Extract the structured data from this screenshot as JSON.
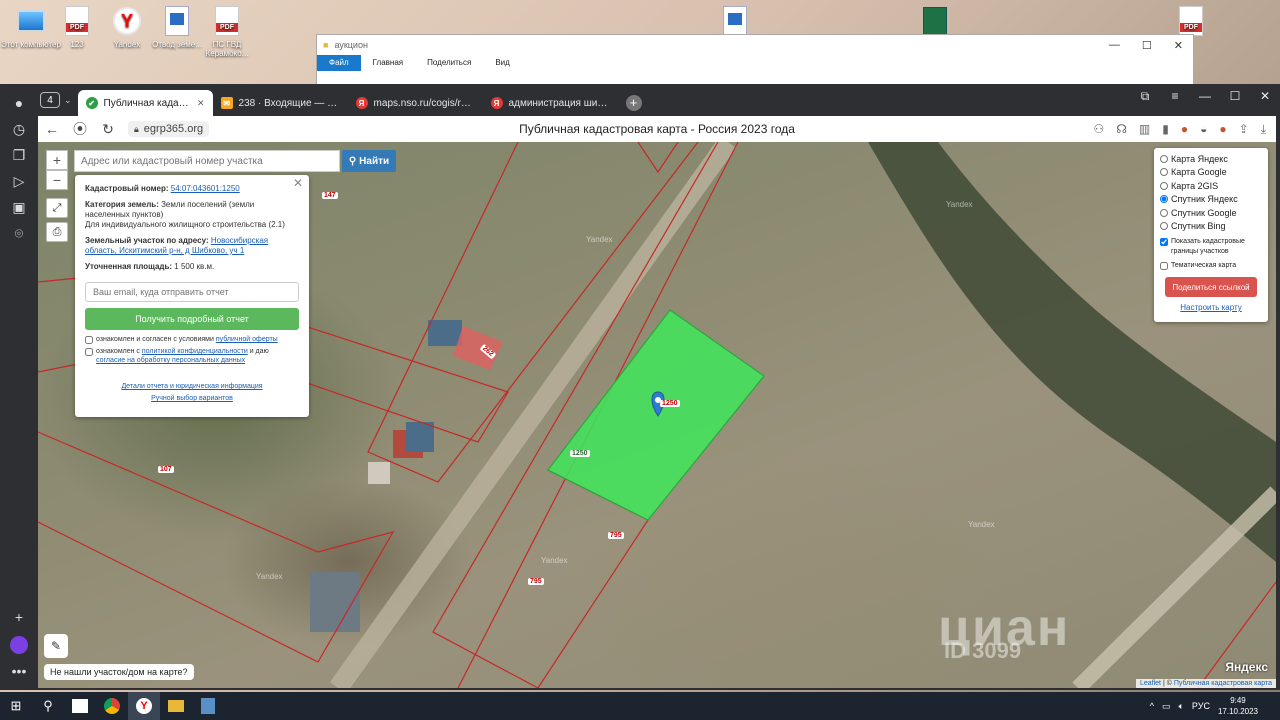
{
  "desktop": {
    "icons": [
      {
        "label": "Этот компьютер",
        "type": "pc"
      },
      {
        "label": "123",
        "type": "pdf"
      },
      {
        "label": "Yandex",
        "type": "yandex"
      },
      {
        "label": "Отвод земе...",
        "type": "doc"
      },
      {
        "label": "ПС ГВД Керамоко...",
        "type": "pdf"
      }
    ]
  },
  "explorer": {
    "title": "аукцион",
    "ribbon": [
      "Файл",
      "Главная",
      "Поделиться",
      "Вид"
    ]
  },
  "browser": {
    "tab_count": "4",
    "tabs": [
      {
        "label": "Публичная кадастрова",
        "icon_color": "#2e9e44",
        "icon": "✔"
      },
      {
        "label": "238 · Входящие — Яндекс",
        "icon_color": "#f5a623",
        "icon": "✉"
      },
      {
        "label": "maps.nso.ru/cogis/regional",
        "icon_color": "#e53935",
        "icon": "Я"
      },
      {
        "label": "администрация шибковс",
        "icon_color": "#e53935",
        "icon": "Я"
      }
    ],
    "url": "egrp365.org",
    "page_title": "Публичная кадастровая карта - Россия 2023 года"
  },
  "map": {
    "search_placeholder": "Адрес или кадастровый номер участка",
    "search_button": "Найти",
    "info": {
      "cad_num_label": "Кадастровый номер:",
      "cad_num": "54:07:043601:1250",
      "category_label": "Категория земель:",
      "category": "Земли поселений (земли населенных пунктов)",
      "usage": "Для индивидуального жилищного строительства (2.1)",
      "address_label": "Земельный участок по адресу:",
      "address": "Новосибирская область, Искитимский р-н, д Шибково, уч 1",
      "area_label": "Уточненная площадь:",
      "area": "1 500 кв.м.",
      "email_placeholder": "Ваш email, куда отправить отчет",
      "get_report": "Получить подробный отчет",
      "agree1_prefix": "ознакомлен и согласен с условиями",
      "agree1_link": "публичной оферты",
      "agree2_prefix": "ознакомлен с",
      "agree2_link": "политикой конфиденциальности",
      "agree2_mid": "и даю",
      "agree2_link2": "согласие на обработку персональных данных",
      "footer1": "Детали отчета и юридическая информация",
      "footer2": "Ручной выбор вариантов"
    },
    "layers": {
      "options": [
        "Карта Яндекс",
        "Карта Google",
        "Карта 2GIS",
        "Спутник Яндекс",
        "Спутник Google",
        "Спутник Bing"
      ],
      "selected_index": 3,
      "show_borders": "Показать кадастровые границы участков",
      "thematic": "Тематическая карта",
      "share": "Поделиться ссылкой",
      "configure": "Настроить карту"
    },
    "parcel_labels": [
      "147",
      "1250",
      "1250",
      "795",
      "795",
      "107",
      "262"
    ],
    "watermark": "Yandex",
    "not_found": "Не нашли участок/дом на карте?",
    "attribution_leaflet": "Leaflet",
    "attribution_source": "Публичная кадастровая карта",
    "yandex_logo": "Яндекс",
    "cian": "циан",
    "cian_id": "ID 3099"
  },
  "taskbar": {
    "lang": "РУС",
    "time": "9:49",
    "date": "17.10.2023"
  },
  "colors": {
    "parcel_fill": "#3ee85a",
    "parcel_border": "#c62828",
    "search_button": "#337ab7",
    "report_button": "#5cb85c",
    "share_button": "#d9534f"
  }
}
